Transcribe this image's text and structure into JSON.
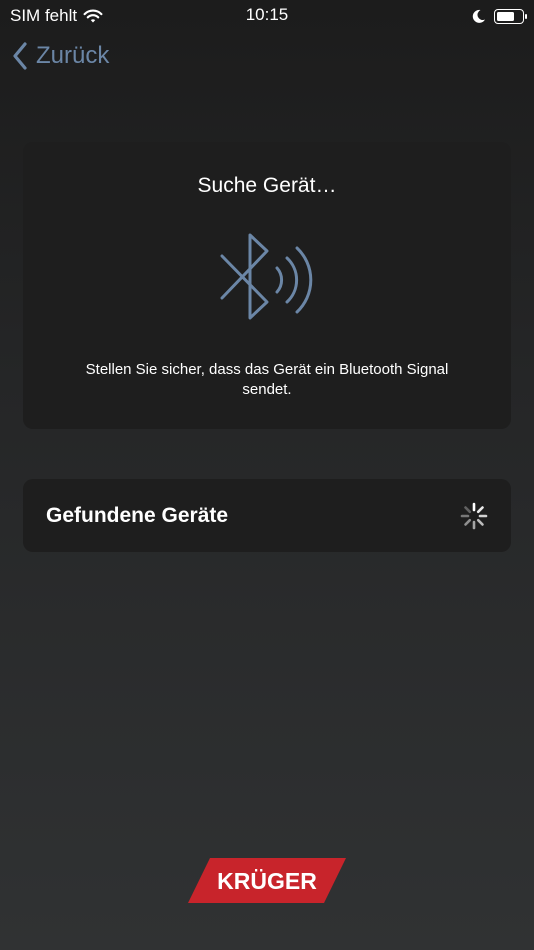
{
  "status_bar": {
    "carrier": "SIM fehlt",
    "time": "10:15",
    "wifi_icon": "wifi-icon",
    "dnd_icon": "moon-icon",
    "battery_icon": "battery-icon",
    "battery_level": 0.7
  },
  "nav": {
    "back_label": "Zurück",
    "back_icon": "chevron-left-icon"
  },
  "search_card": {
    "title": "Suche Gerät…",
    "icon": "bluetooth-searching-icon",
    "hint": "Stellen Sie sicher, dass das Gerät ein Bluetooth Signal sendet."
  },
  "found_devices": {
    "title": "Gefundene Geräte",
    "spinner_icon": "loading-spinner-icon"
  },
  "brand": {
    "logo_text": "KRÜGER",
    "logo_color": "#c8242b"
  },
  "colors": {
    "accent": "#6b86a6",
    "card_bg": "#1e1e1e"
  }
}
